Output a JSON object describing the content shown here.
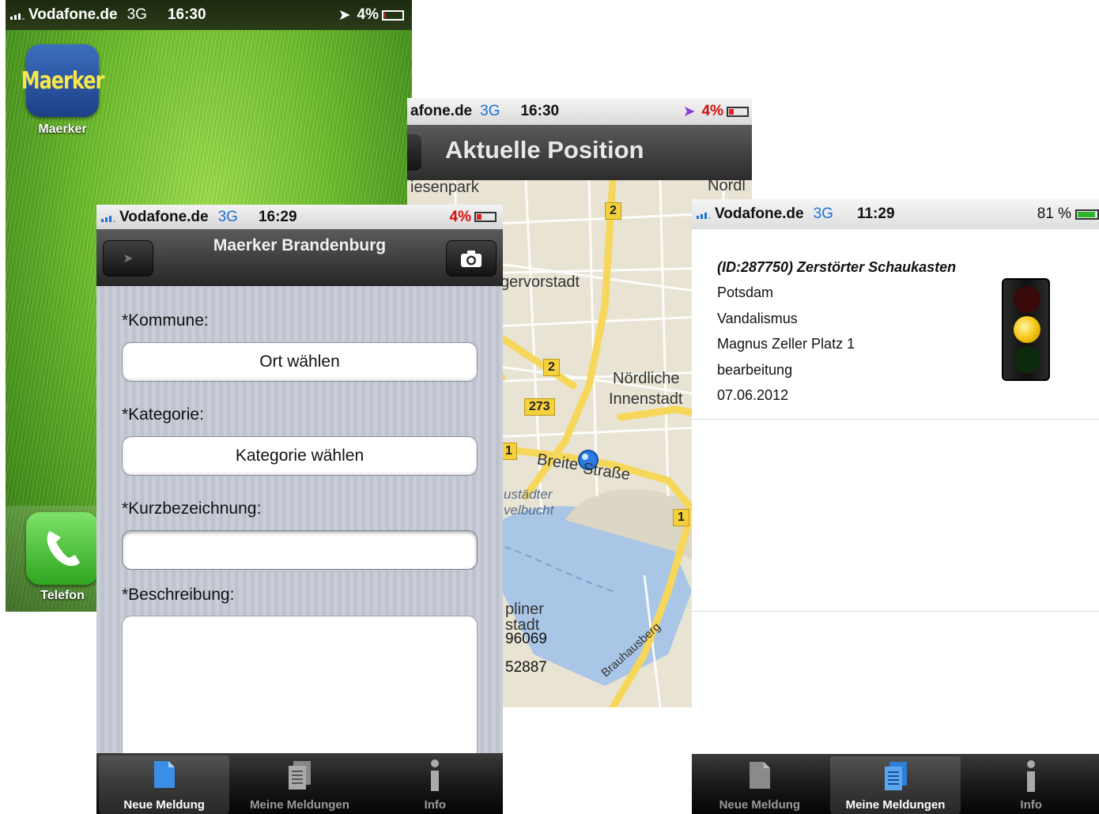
{
  "home": {
    "status": {
      "carrier": "Vodafone.de",
      "network": "3G",
      "time": "16:30",
      "battery": "4%"
    },
    "apps": [
      {
        "name": "Maerker",
        "icon_text": "Maerker",
        "icon": "maerker-app-icon"
      },
      {
        "name": "Telefon",
        "icon": "phone-icon"
      }
    ]
  },
  "map": {
    "status": {
      "carrier": "afone.de",
      "network": "3G",
      "time": "16:30",
      "battery": "4%"
    },
    "title": "Aktuelle Position",
    "labels": {
      "wiesenpark": "iesenpark",
      "nord": "Nordl",
      "vorstadt": "gervorstadt",
      "noerdliche": "Nördliche",
      "innenstadt": "Innenstadt",
      "breite_a": "Breite",
      "breite_b": "Straße",
      "neustaedter_a": "ustädter",
      "neustaedter_b": "velbucht",
      "templiner_a": "pliner",
      "templiner_b": "stadt",
      "brauhaus": "Brauhausberg",
      "coord_a": "96069",
      "coord_b": "52887"
    },
    "shields": {
      "s1": "2",
      "s2": "2",
      "s3": "273",
      "s4": "1",
      "s5": "1"
    }
  },
  "form": {
    "status": {
      "carrier": "Vodafone.de",
      "network": "3G",
      "time": "16:29",
      "battery": "4%"
    },
    "title": "Maerker Brandenburg",
    "kommune_label": "*Kommune:",
    "kommune_button": "Ort wählen",
    "kategorie_label": "*Kategorie:",
    "kategorie_button": "Kategorie wählen",
    "kurz_label": "*Kurzbezeichnung:",
    "kurz_value": "",
    "beschreibung_label": "*Beschreibung:",
    "beschreibung_value": "",
    "tabs": [
      "Neue Meldung",
      "Meine Meldungen",
      "Info"
    ],
    "selected_tab": "Neue Meldung"
  },
  "detail": {
    "status": {
      "carrier": "Vodafone.de",
      "network": "3G",
      "time": "11:29",
      "battery": "81 %"
    },
    "title": "(ID:287750) Zerstörter Schaukasten",
    "city": "Potsdam",
    "category": "Vandalismus",
    "address": "Magnus Zeller Platz 1",
    "state": "bearbeitung",
    "date": "07.06.2012",
    "traffic_light": "yellow",
    "tabs": [
      "Neue Meldung",
      "Meine Meldungen",
      "Info"
    ],
    "selected_tab": "Meine Meldungen"
  },
  "colors": {
    "network_3g": "#1f6fd6",
    "battery_low": "#d01010",
    "battery_ok": "#2fb52a",
    "map_road": "#fbe37a",
    "map_water": "#a9c6e6"
  }
}
